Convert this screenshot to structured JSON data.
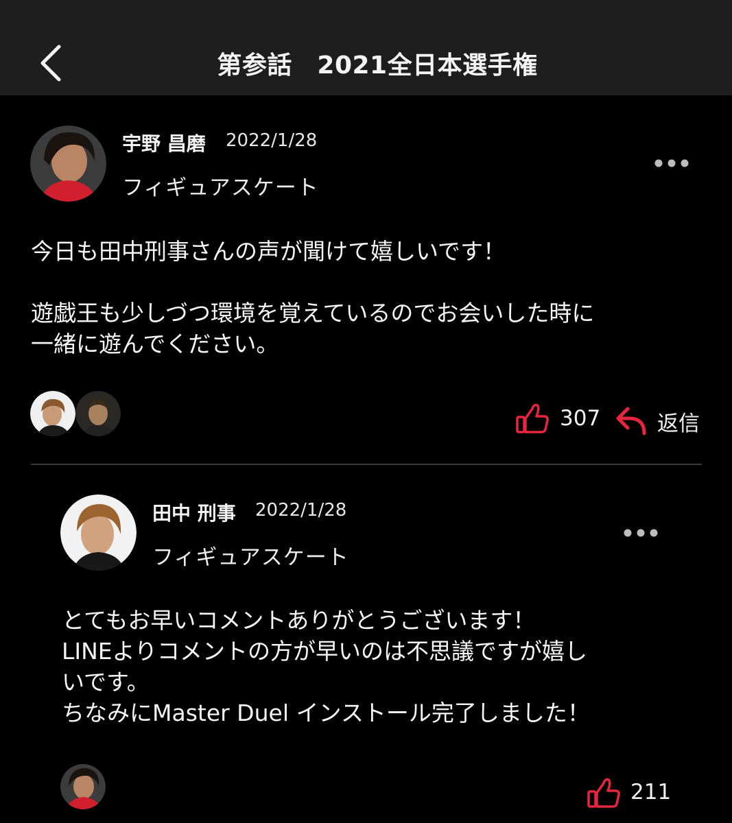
{
  "header": {
    "title": "第参話　2021全日本選手権",
    "back_icon": "chevron-left-icon"
  },
  "colors": {
    "accent": "#e8253f",
    "background": "#000000",
    "header_bg": "#1e1e1e",
    "divider": "#3a3a3a"
  },
  "post": {
    "author": "宇野 昌磨",
    "date": "2022/1/28",
    "category": "フィギュアスケート",
    "more_icon": "more-dots-icon",
    "body_line1": "今日も田中刑事さんの声が聞けて嬉しいです！",
    "body_line2": "遊戯王も少しづつ環境を覚えているのでお会いした時に\n一緒に遊んでください。",
    "like_count": "307",
    "reply_label": "返信"
  },
  "reply": {
    "author": "田中 刑事",
    "date": "2022/1/28",
    "category": "フィギュアスケート",
    "more_icon": "more-dots-icon",
    "body": "とてもお早いコメントありがとうございます！\nLINEよりコメントの方が早いのは不思議ですが嬉し\nいです。\nちなみにMaster Duel インストール完了しました！",
    "like_count": "211"
  }
}
